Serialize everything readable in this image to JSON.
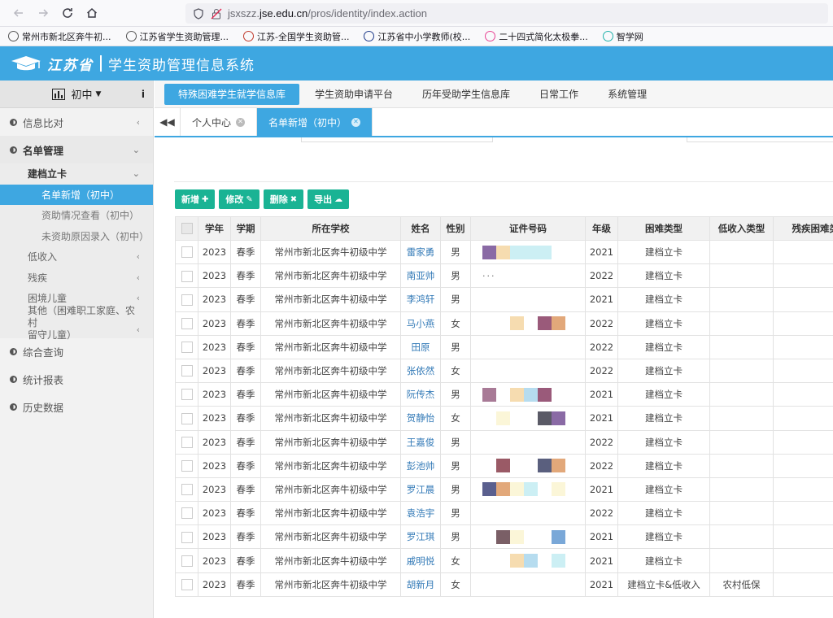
{
  "browser": {
    "url_prefix": "jsxszz.",
    "url_domain": "jse.edu.cn",
    "url_path": "/pros/identity/index.action",
    "bookmarks": [
      {
        "label": "常州市新北区奔牛初...",
        "color": "#555"
      },
      {
        "label": "江苏省学生资助管理...",
        "color": "#555"
      },
      {
        "label": "江苏-全国学生资助管...",
        "color": "#c0392b"
      },
      {
        "label": "江苏省中小学教师(校...",
        "color": "#1f3b8a"
      },
      {
        "label": "二十四式简化太极拳...",
        "color": "#e84393"
      },
      {
        "label": "智学网",
        "color": "#20b2aa"
      }
    ]
  },
  "header": {
    "province": "江苏省",
    "title": "学生资助管理信息系统"
  },
  "sidebar": {
    "level": "初中",
    "info": "i",
    "items": [
      {
        "label": "信息比对",
        "arrow": "‹"
      },
      {
        "label": "名单管理",
        "arrow": "⌄"
      },
      {
        "label": "综合查询"
      },
      {
        "label": "统计报表"
      },
      {
        "label": "历史数据"
      }
    ],
    "sub": {
      "jiandang": "建档立卡",
      "leaves": [
        "名单新增（初中）",
        "资助情况查看（初中）",
        "未资助原因录入（初中）"
      ],
      "others": [
        "低收入",
        "残疾",
        "困境儿童"
      ],
      "other_line1": "其他（困难职工家庭、农村",
      "other_line2": "留守儿童）"
    }
  },
  "topnav": [
    "特殊困难学生就学信息库",
    "学生资助申请平台",
    "历年受助学生信息库",
    "日常工作",
    "系统管理"
  ],
  "tabs": [
    "个人中心",
    "名单新增（初中）"
  ],
  "toolbar": {
    "add": "新增",
    "edit": "修改",
    "delete": "删除",
    "export": "导出"
  },
  "table": {
    "headers": [
      "学年",
      "学期",
      "所在学校",
      "姓名",
      "性别",
      "证件号码",
      "年级",
      "困难类型",
      "低收入类型",
      "残疾困难类型"
    ],
    "rows": [
      {
        "year": "2023",
        "term": "春季",
        "school": "常州市新北区奔牛初级中学",
        "name": "雷家勇",
        "gender": "男",
        "grade": "2021",
        "type": "建档立卡",
        "low": "",
        "pix": [
          "#8a6aa5",
          "#f6dcb0",
          "#cceff4",
          "#cceff4",
          "#cceff4"
        ]
      },
      {
        "year": "2023",
        "term": "春季",
        "school": "常州市新北区奔牛初级中学",
        "name": "南亚帅",
        "gender": "男",
        "grade": "2022",
        "type": "建档立卡",
        "low": "",
        "pix": []
      },
      {
        "year": "2023",
        "term": "春季",
        "school": "常州市新北区奔牛初级中学",
        "name": "李鸿轩",
        "gender": "男",
        "grade": "2021",
        "type": "建档立卡",
        "low": "",
        "pix": []
      },
      {
        "year": "2023",
        "term": "春季",
        "school": "常州市新北区奔牛初级中学",
        "name": "马小燕",
        "gender": "女",
        "grade": "2022",
        "type": "建档立卡",
        "low": "",
        "pix": [
          "#fff",
          "#fff",
          "#f6dcb0",
          "#fff",
          "#9a5a7a",
          "#e2a87a"
        ]
      },
      {
        "year": "2023",
        "term": "春季",
        "school": "常州市新北区奔牛初级中学",
        "name": "田原",
        "gender": "男",
        "grade": "2022",
        "type": "建档立卡",
        "low": "",
        "pix": []
      },
      {
        "year": "2023",
        "term": "春季",
        "school": "常州市新北区奔牛初级中学",
        "name": "张依然",
        "gender": "女",
        "grade": "2022",
        "type": "建档立卡",
        "low": "",
        "pix": []
      },
      {
        "year": "2023",
        "term": "春季",
        "school": "常州市新北区奔牛初级中学",
        "name": "阮传杰",
        "gender": "男",
        "grade": "2021",
        "type": "建档立卡",
        "low": "",
        "pix": [
          "#a87a96",
          "#fff",
          "#f6dcb0",
          "#b6dcef",
          "#9a5a7a"
        ]
      },
      {
        "year": "2023",
        "term": "春季",
        "school": "常州市新北区奔牛初级中学",
        "name": "贺静怡",
        "gender": "女",
        "grade": "2021",
        "type": "建档立卡",
        "low": "",
        "pix": [
          "#fff",
          "#fbf6d8",
          "#fff",
          "#fff",
          "#5a5a66",
          "#8a6aa5"
        ]
      },
      {
        "year": "2023",
        "term": "春季",
        "school": "常州市新北区奔牛初级中学",
        "name": "王嘉俊",
        "gender": "男",
        "grade": "2022",
        "type": "建档立卡",
        "low": "",
        "pix": []
      },
      {
        "year": "2023",
        "term": "春季",
        "school": "常州市新北区奔牛初级中学",
        "name": "彭池帅",
        "gender": "男",
        "grade": "2022",
        "type": "建档立卡",
        "low": "",
        "pix": [
          "#fff",
          "#9a5a66",
          "#fff",
          "#fff",
          "#5a5f7e",
          "#e2a87a"
        ]
      },
      {
        "year": "2023",
        "term": "春季",
        "school": "常州市新北区奔牛初级中学",
        "name": "罗江晨",
        "gender": "男",
        "grade": "2021",
        "type": "建档立卡",
        "low": "",
        "pix": [
          "#5a5f8e",
          "#e2a87a",
          "#fbf6d8",
          "#cceff4",
          "#fff",
          "#fbf6d8"
        ]
      },
      {
        "year": "2023",
        "term": "春季",
        "school": "常州市新北区奔牛初级中学",
        "name": "袁浩宇",
        "gender": "男",
        "grade": "2022",
        "type": "建档立卡",
        "low": "",
        "pix": []
      },
      {
        "year": "2023",
        "term": "春季",
        "school": "常州市新北区奔牛初级中学",
        "name": "罗江琪",
        "gender": "男",
        "grade": "2021",
        "type": "建档立卡",
        "low": "",
        "pix": [
          "#fff",
          "#7a5f66",
          "#fbf6d8",
          "#fff",
          "#fff",
          "#7aa8d8"
        ]
      },
      {
        "year": "2023",
        "term": "春季",
        "school": "常州市新北区奔牛初级中学",
        "name": "戚明悦",
        "gender": "女",
        "grade": "2021",
        "type": "建档立卡",
        "low": "",
        "pix": [
          "#fff",
          "#fff",
          "#f6dcb0",
          "#b6dcef",
          "#fff",
          "#cceff4"
        ]
      },
      {
        "year": "2023",
        "term": "春季",
        "school": "常州市新北区奔牛初级中学",
        "name": "胡新月",
        "gender": "女",
        "grade": "2021",
        "type": "建档立卡&低收入",
        "low": "农村低保",
        "pix": []
      }
    ]
  },
  "colors": {
    "accent": "#3ea7e1",
    "green_button": "#1ab394"
  }
}
